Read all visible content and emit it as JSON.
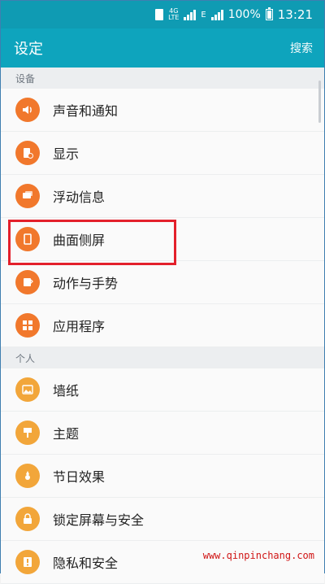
{
  "status_bar": {
    "network_top": "4G",
    "network_bottom": "LTE",
    "signal_label": "E",
    "battery": "100%",
    "time": "13:21"
  },
  "appbar": {
    "title": "设定",
    "search": "搜索"
  },
  "sections": [
    {
      "header": "设备",
      "items": [
        {
          "label": "声音和通知",
          "icon": "speaker-icon",
          "color": "#f1782c"
        },
        {
          "label": "显示",
          "icon": "display-icon",
          "color": "#f1782c"
        },
        {
          "label": "浮动信息",
          "icon": "chat-icon",
          "color": "#f1782c"
        },
        {
          "label": "曲面侧屏",
          "icon": "edge-screen-icon",
          "color": "#f1782c"
        },
        {
          "label": "动作与手势",
          "icon": "gesture-icon",
          "color": "#f1782c"
        },
        {
          "label": "应用程序",
          "icon": "apps-icon",
          "color": "#f1782c"
        }
      ]
    },
    {
      "header": "个人",
      "items": [
        {
          "label": "墙纸",
          "icon": "wallpaper-icon",
          "color": "#f2a63a"
        },
        {
          "label": "主题",
          "icon": "theme-icon",
          "color": "#f2a63a"
        },
        {
          "label": "节日效果",
          "icon": "festival-icon",
          "color": "#f2a63a"
        },
        {
          "label": "锁定屏幕与安全",
          "icon": "lock-icon",
          "color": "#f2a63a"
        },
        {
          "label": "隐私和安全",
          "icon": "privacy-icon",
          "color": "#f2a63a"
        }
      ]
    }
  ],
  "watermark": "www.qinpinchang.com"
}
